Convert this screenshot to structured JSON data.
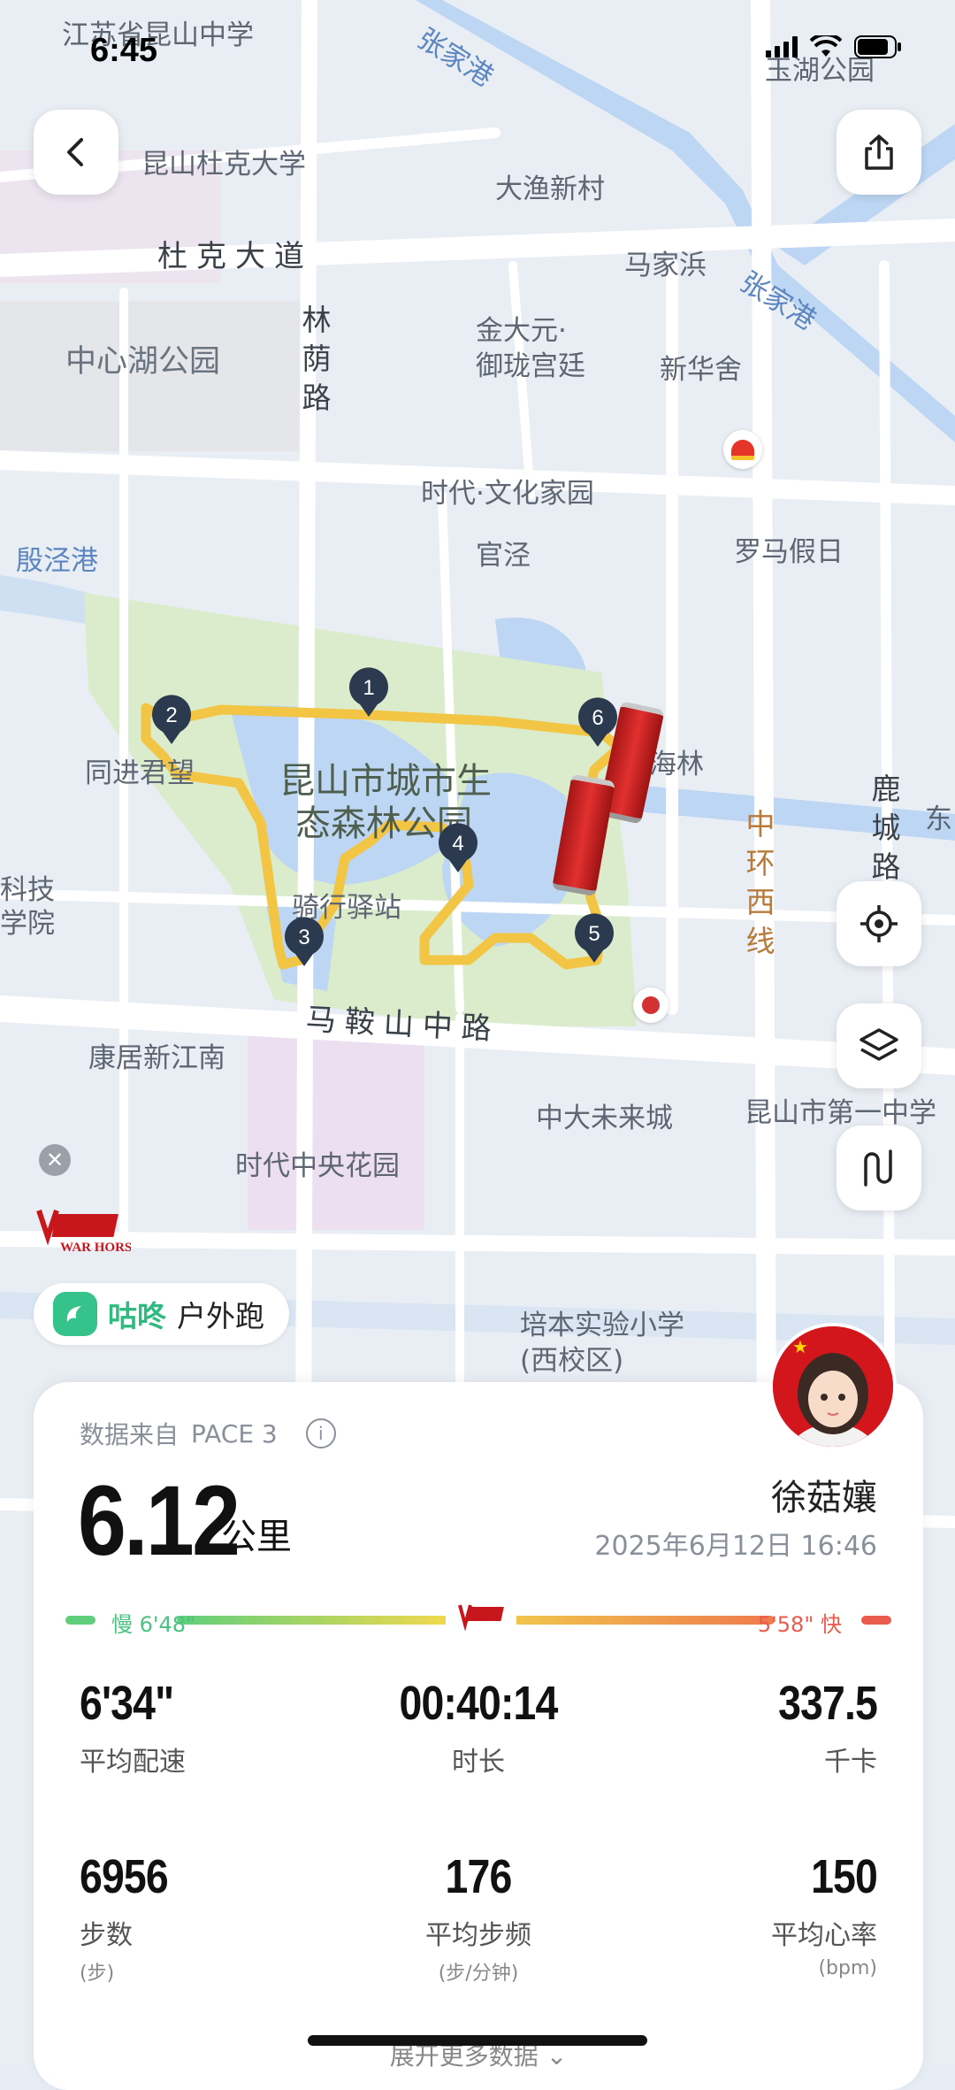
{
  "status_bar": {
    "time": "6:45"
  },
  "map": {
    "labels": {
      "l1": "江苏省昆山中学",
      "l2": "张家港",
      "l3": "玉湖公园",
      "l4": "昆山杜克大学",
      "l5": "大渔新村",
      "l6": "杜克大道",
      "l7": "马家浜",
      "l8": "张家港",
      "l9": "中心湖公园",
      "l10": "林荫路",
      "l11": "金大元·",
      "l12": "御珑宫廷",
      "l13": "新华舍",
      "l14": "时代·文化家园",
      "l15": "殷泾港",
      "l16": "官泾",
      "l17": "罗马假日",
      "l18": "同进君望",
      "l19": "昆山市城市生",
      "l20": "态森林公园",
      "l21": "海林",
      "l22": "鹿城路",
      "l23": "中环西线",
      "l24": "骑行驿站",
      "l25": "马鞍山中路",
      "l26": "康居新江南",
      "l27": "中大未来城",
      "l28": "昆山市第一中学",
      "l29": "时代中央花园",
      "l30": "培本实验小学",
      "l31": "(西校区)",
      "l32": "科技",
      "l33": "学院",
      "l34": "东"
    },
    "markers": [
      "1",
      "2",
      "3",
      "4",
      "5",
      "6"
    ]
  },
  "controls": {
    "back_icon": "chevron-left-icon",
    "share_icon": "share-icon",
    "locate_icon": "locate-icon",
    "layers_icon": "layers-icon",
    "route_icon": "route-icon"
  },
  "ad": {
    "brand_text": "WAR HORSE"
  },
  "app_badge": {
    "brand": "咕咚",
    "label": "户外跑"
  },
  "summary": {
    "source_label": "数据来自",
    "source_device": "PACE 3",
    "distance": "6.12",
    "distance_unit": "公里",
    "user_name": "徐菇孃",
    "datetime": "2025年6月12日 16:46",
    "pace_slow": "慢 6'48\"",
    "pace_fast": "5'58\" 快",
    "stats": [
      {
        "value": "6'34\"",
        "label": "平均配速"
      },
      {
        "value": "00:40:14",
        "label": "时长"
      },
      {
        "value": "337.5",
        "label": "千卡"
      },
      {
        "value": "6956",
        "label": "步数",
        "unit": "(步)"
      },
      {
        "value": "176",
        "label": "平均步频",
        "unit": "(步/分钟)"
      },
      {
        "value": "150",
        "label": "平均心率",
        "unit": "(bpm)"
      }
    ],
    "more_label": "展开更多数据"
  },
  "colors": {
    "route": "#f2c544",
    "water": "#bcd6f3",
    "park": "#e3f1d8",
    "pace_slow": "#49c37f",
    "pace_fast": "#e85b4d"
  }
}
